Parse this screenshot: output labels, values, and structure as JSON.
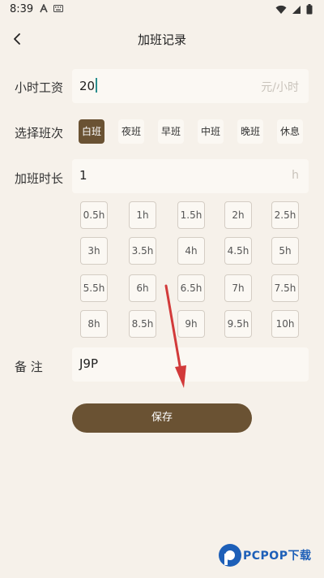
{
  "status_bar": {
    "time": "8:39"
  },
  "nav": {
    "title": "加班记录"
  },
  "wage": {
    "label": "小时工资",
    "value": "20",
    "suffix": "元/小时"
  },
  "shift": {
    "label": "选择班次",
    "options": [
      "白班",
      "夜班",
      "早班",
      "中班",
      "晚班",
      "休息"
    ],
    "selected": "白班"
  },
  "overtime": {
    "label": "加班时长",
    "value": "1",
    "suffix": "h"
  },
  "hour_presets": [
    "0.5h",
    "1h",
    "1.5h",
    "2h",
    "2.5h",
    "3h",
    "3.5h",
    "4h",
    "4.5h",
    "5h",
    "5.5h",
    "6h",
    "6.5h",
    "7h",
    "7.5h",
    "8h",
    "8.5h",
    "9h",
    "9.5h",
    "10h"
  ],
  "note": {
    "label": "备 注",
    "value": "J9P"
  },
  "save_label": "保存",
  "overlay": {
    "arrow_color": "#d23a3a"
  },
  "watermark": {
    "brand": "PCPOP下载"
  },
  "colors": {
    "background": "#f6f1ea",
    "accent": "#6a5233",
    "field": "#fbf8f3"
  }
}
